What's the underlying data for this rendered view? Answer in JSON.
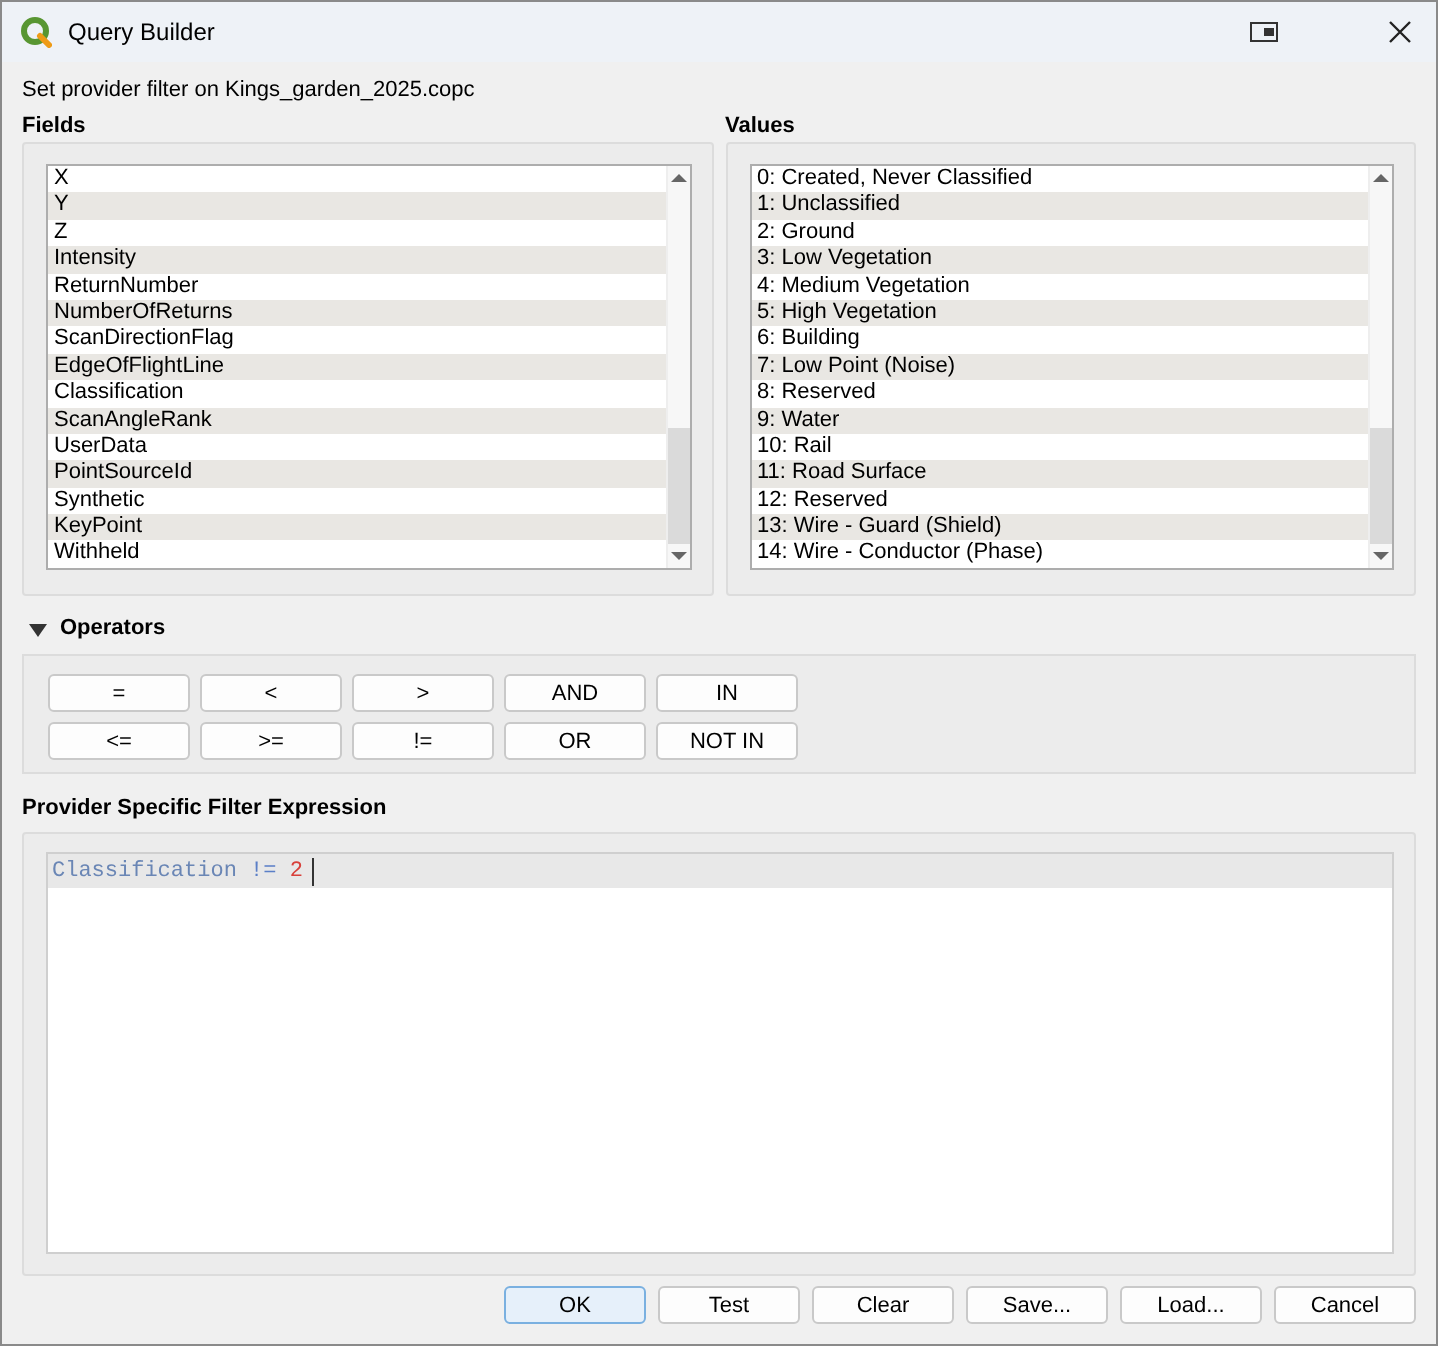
{
  "window": {
    "title": "Query Builder"
  },
  "subtitle": "Set provider filter on Kings_garden_2025.copc",
  "fields": {
    "title": "Fields",
    "items": [
      "X",
      "Y",
      "Z",
      "Intensity",
      "ReturnNumber",
      "NumberOfReturns",
      "ScanDirectionFlag",
      "EdgeOfFlightLine",
      "Classification",
      "ScanAngleRank",
      "UserData",
      "PointSourceId",
      "Synthetic",
      "KeyPoint",
      "Withheld"
    ]
  },
  "values": {
    "title": "Values",
    "items": [
      "0: Created, Never Classified",
      "1: Unclassified",
      "2: Ground",
      "3: Low Vegetation",
      "4: Medium Vegetation",
      "5: High Vegetation",
      "6: Building",
      "7: Low Point (Noise)",
      "8: Reserved",
      "9: Water",
      "10: Rail",
      "11: Road Surface",
      "12: Reserved",
      "13: Wire - Guard (Shield)",
      "14: Wire - Conductor (Phase)"
    ]
  },
  "operators": {
    "title": "Operators",
    "expanded": true,
    "rows": [
      [
        "=",
        "<",
        ">",
        "AND",
        "IN"
      ],
      [
        "<=",
        ">=",
        "!=",
        "OR",
        "NOT IN"
      ]
    ]
  },
  "expression": {
    "title": "Provider Specific Filter Expression",
    "tokens": [
      {
        "kind": "field",
        "text": "Classification"
      },
      {
        "kind": "operator",
        "text": "!="
      },
      {
        "kind": "number",
        "text": "2"
      }
    ]
  },
  "buttons": [
    {
      "label": "OK",
      "default": true
    },
    {
      "label": "Test",
      "default": false
    },
    {
      "label": "Clear",
      "default": false
    },
    {
      "label": "Save...",
      "default": false
    },
    {
      "label": "Load...",
      "default": false
    },
    {
      "label": "Cancel",
      "default": false
    }
  ]
}
